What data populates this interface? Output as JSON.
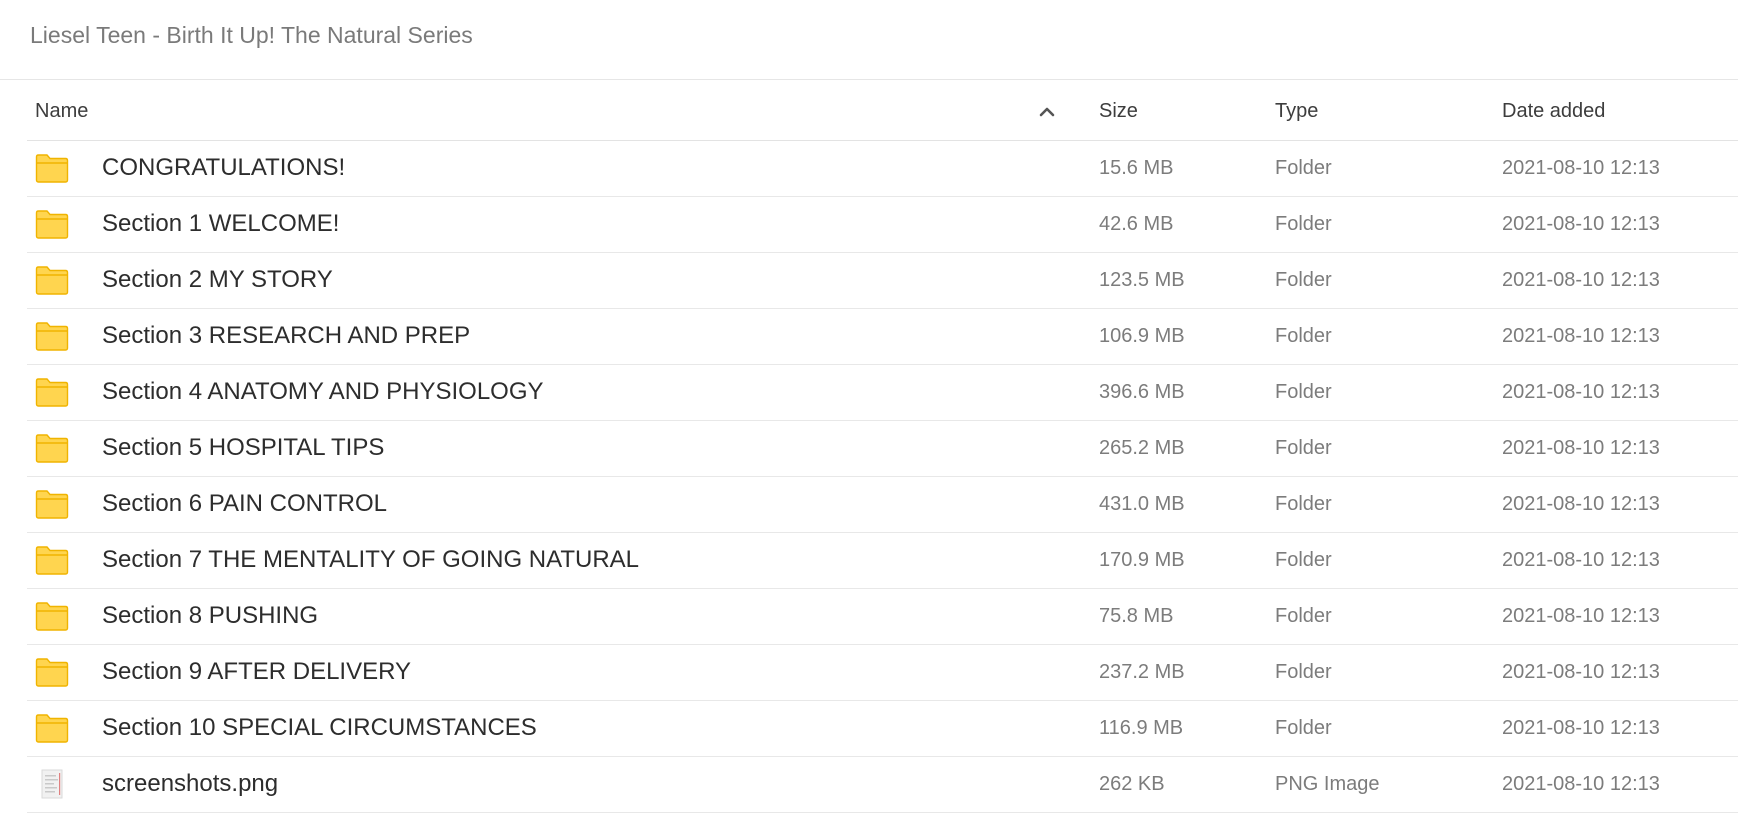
{
  "breadcrumb": "Liesel Teen - Birth It Up! The Natural Series",
  "columns": {
    "name": "Name",
    "size": "Size",
    "type": "Type",
    "date": "Date added"
  },
  "sort": {
    "column": "Name",
    "direction": "ascending",
    "icon": "chevron-up-icon"
  },
  "colors": {
    "folder": "#ffd54f",
    "folder_edge": "#f0b400"
  },
  "rows": [
    {
      "name": "CONGRATULATIONS!",
      "size": "15.6 MB",
      "type": "Folder",
      "date": "2021-08-10 12:13",
      "icon": "folder-icon"
    },
    {
      "name": "Section 1 WELCOME!",
      "size": "42.6 MB",
      "type": "Folder",
      "date": "2021-08-10 12:13",
      "icon": "folder-icon"
    },
    {
      "name": "Section 2 MY STORY",
      "size": "123.5 MB",
      "type": "Folder",
      "date": "2021-08-10 12:13",
      "icon": "folder-icon"
    },
    {
      "name": "Section 3 RESEARCH AND PREP",
      "size": "106.9 MB",
      "type": "Folder",
      "date": "2021-08-10 12:13",
      "icon": "folder-icon"
    },
    {
      "name": "Section 4 ANATOMY AND PHYSIOLOGY",
      "size": "396.6 MB",
      "type": "Folder",
      "date": "2021-08-10 12:13",
      "icon": "folder-icon"
    },
    {
      "name": "Section 5 HOSPITAL TIPS",
      "size": "265.2 MB",
      "type": "Folder",
      "date": "2021-08-10 12:13",
      "icon": "folder-icon"
    },
    {
      "name": "Section 6 PAIN CONTROL",
      "size": "431.0 MB",
      "type": "Folder",
      "date": "2021-08-10 12:13",
      "icon": "folder-icon"
    },
    {
      "name": "Section 7 THE MENTALITY OF GOING NATURAL",
      "size": "170.9 MB",
      "type": "Folder",
      "date": "2021-08-10 12:13",
      "icon": "folder-icon"
    },
    {
      "name": "Section 8 PUSHING",
      "size": "75.8 MB",
      "type": "Folder",
      "date": "2021-08-10 12:13",
      "icon": "folder-icon"
    },
    {
      "name": "Section 9 AFTER DELIVERY",
      "size": "237.2 MB",
      "type": "Folder",
      "date": "2021-08-10 12:13",
      "icon": "folder-icon"
    },
    {
      "name": "Section 10 SPECIAL CIRCUMSTANCES",
      "size": "116.9 MB",
      "type": "Folder",
      "date": "2021-08-10 12:13",
      "icon": "folder-icon"
    },
    {
      "name": "screenshots.png",
      "size": "262 KB",
      "type": "PNG Image",
      "date": "2021-08-10 12:13",
      "icon": "image-file-icon"
    }
  ]
}
